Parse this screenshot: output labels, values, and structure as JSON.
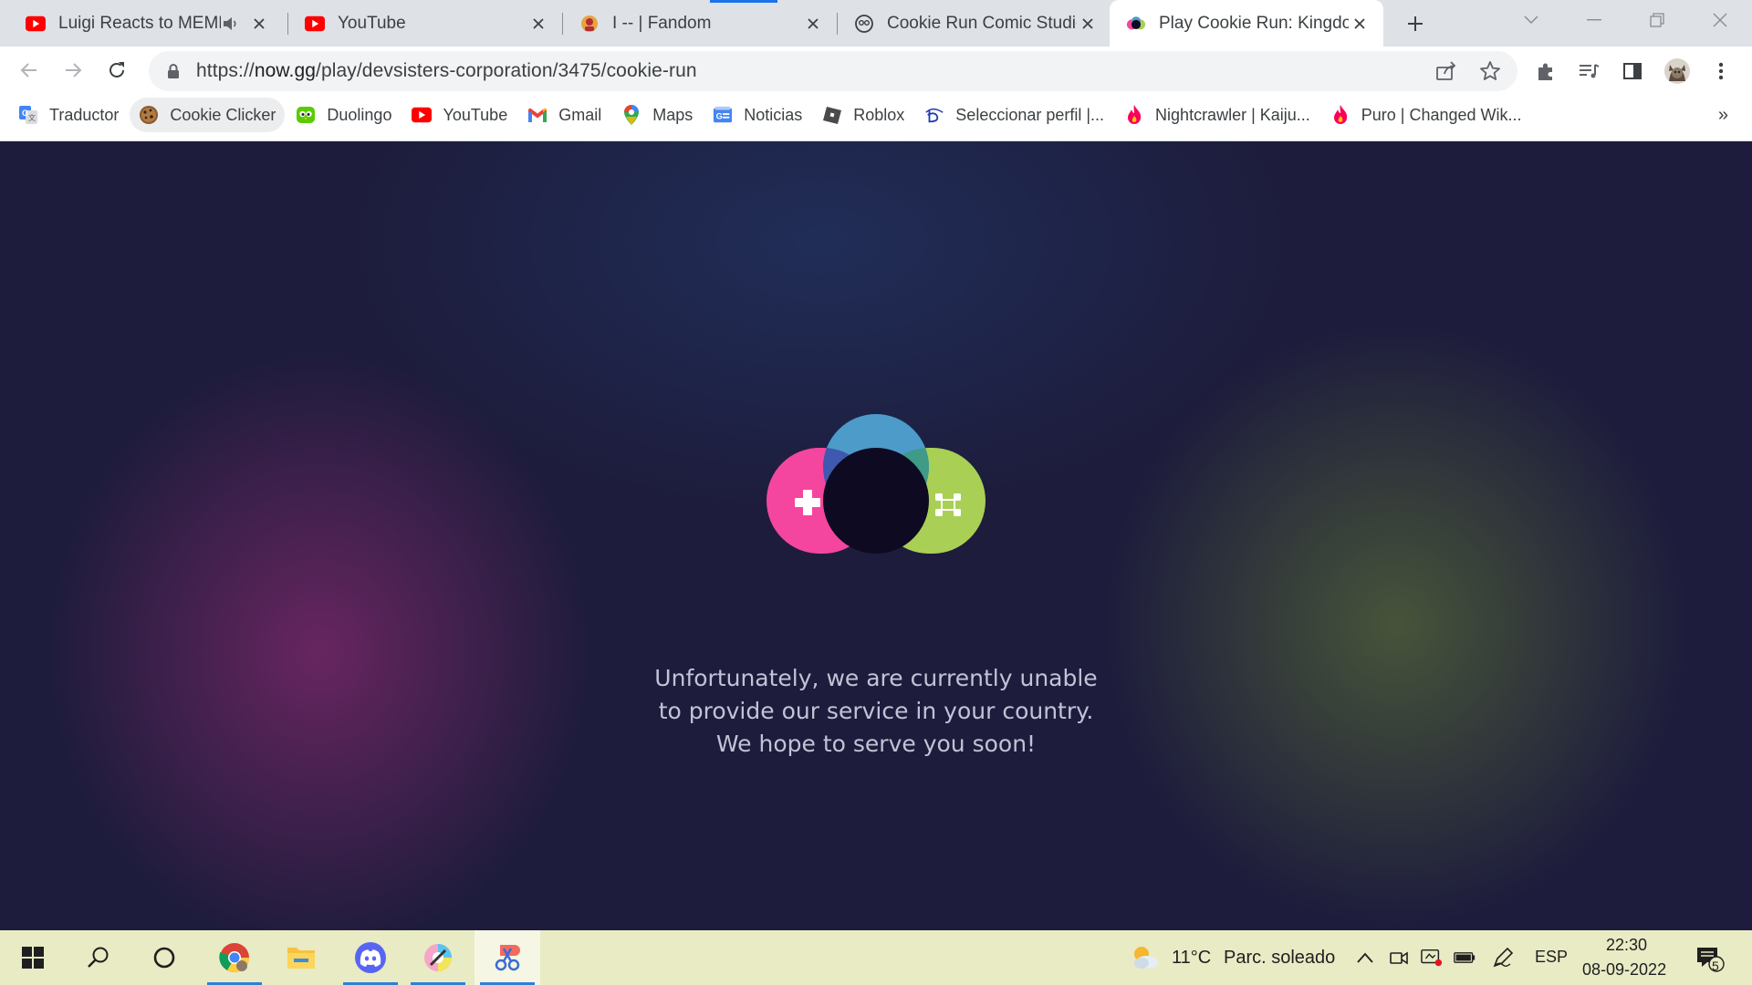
{
  "tabs": [
    {
      "title": "Luigi Reacts to MEME",
      "favicon": "youtube-icon",
      "muted_icon": "speaker-icon"
    },
    {
      "title": "YouTube",
      "favicon": "youtube-icon"
    },
    {
      "title": "I -- | Fandom",
      "favicon": "fandom-icon"
    },
    {
      "title": "Cookie Run Comic Studio",
      "favicon": "comic-studio-icon"
    },
    {
      "title": "Play Cookie Run: Kingdom",
      "favicon": "nowgg-icon",
      "active": true
    }
  ],
  "address_bar": {
    "url_prefix": "https://",
    "url_host": "now.gg",
    "url_path": "/play/devsisters-corporation/3475/cookie-run"
  },
  "bookmarks": [
    {
      "label": "Traductor",
      "icon": "google-translate-icon"
    },
    {
      "label": "Cookie Clicker",
      "icon": "cookie-icon"
    },
    {
      "label": "Duolingo",
      "icon": "duolingo-icon"
    },
    {
      "label": "YouTube",
      "icon": "youtube-icon"
    },
    {
      "label": "Gmail",
      "icon": "gmail-icon"
    },
    {
      "label": "Maps",
      "icon": "maps-pin-icon"
    },
    {
      "label": "Noticias",
      "icon": "news-icon"
    },
    {
      "label": "Roblox",
      "icon": "roblox-icon"
    },
    {
      "label": "Seleccionar perfil |...",
      "icon": "disney-plus-icon"
    },
    {
      "label": "Nightcrawler | Kaiju...",
      "icon": "flame-icon"
    },
    {
      "label": "Puro | Changed Wik...",
      "icon": "flame-icon"
    }
  ],
  "bookmarks_more": "»",
  "page": {
    "message_lines": [
      "Unfortunately, we are currently unable",
      "to provide our service in your country.",
      "We hope to serve you soon!"
    ],
    "colors": {
      "logo_pink": "#f4469e",
      "logo_blue": "#4c9bc9",
      "logo_green": "#a9cf55",
      "logo_center": "#0e0a22"
    }
  },
  "taskbar": {
    "apps": [
      "windows-start-icon",
      "search-icon",
      "cortana-icon",
      "chrome-icon",
      "file-explorer-icon",
      "discord-icon",
      "paint-app-icon",
      "snipping-tool-icon"
    ],
    "weather_temp": "11°C",
    "weather_text": "Parc. soleado",
    "language": "ESP",
    "time": "22:30",
    "date": "08-09-2022",
    "notification_count": "5"
  }
}
